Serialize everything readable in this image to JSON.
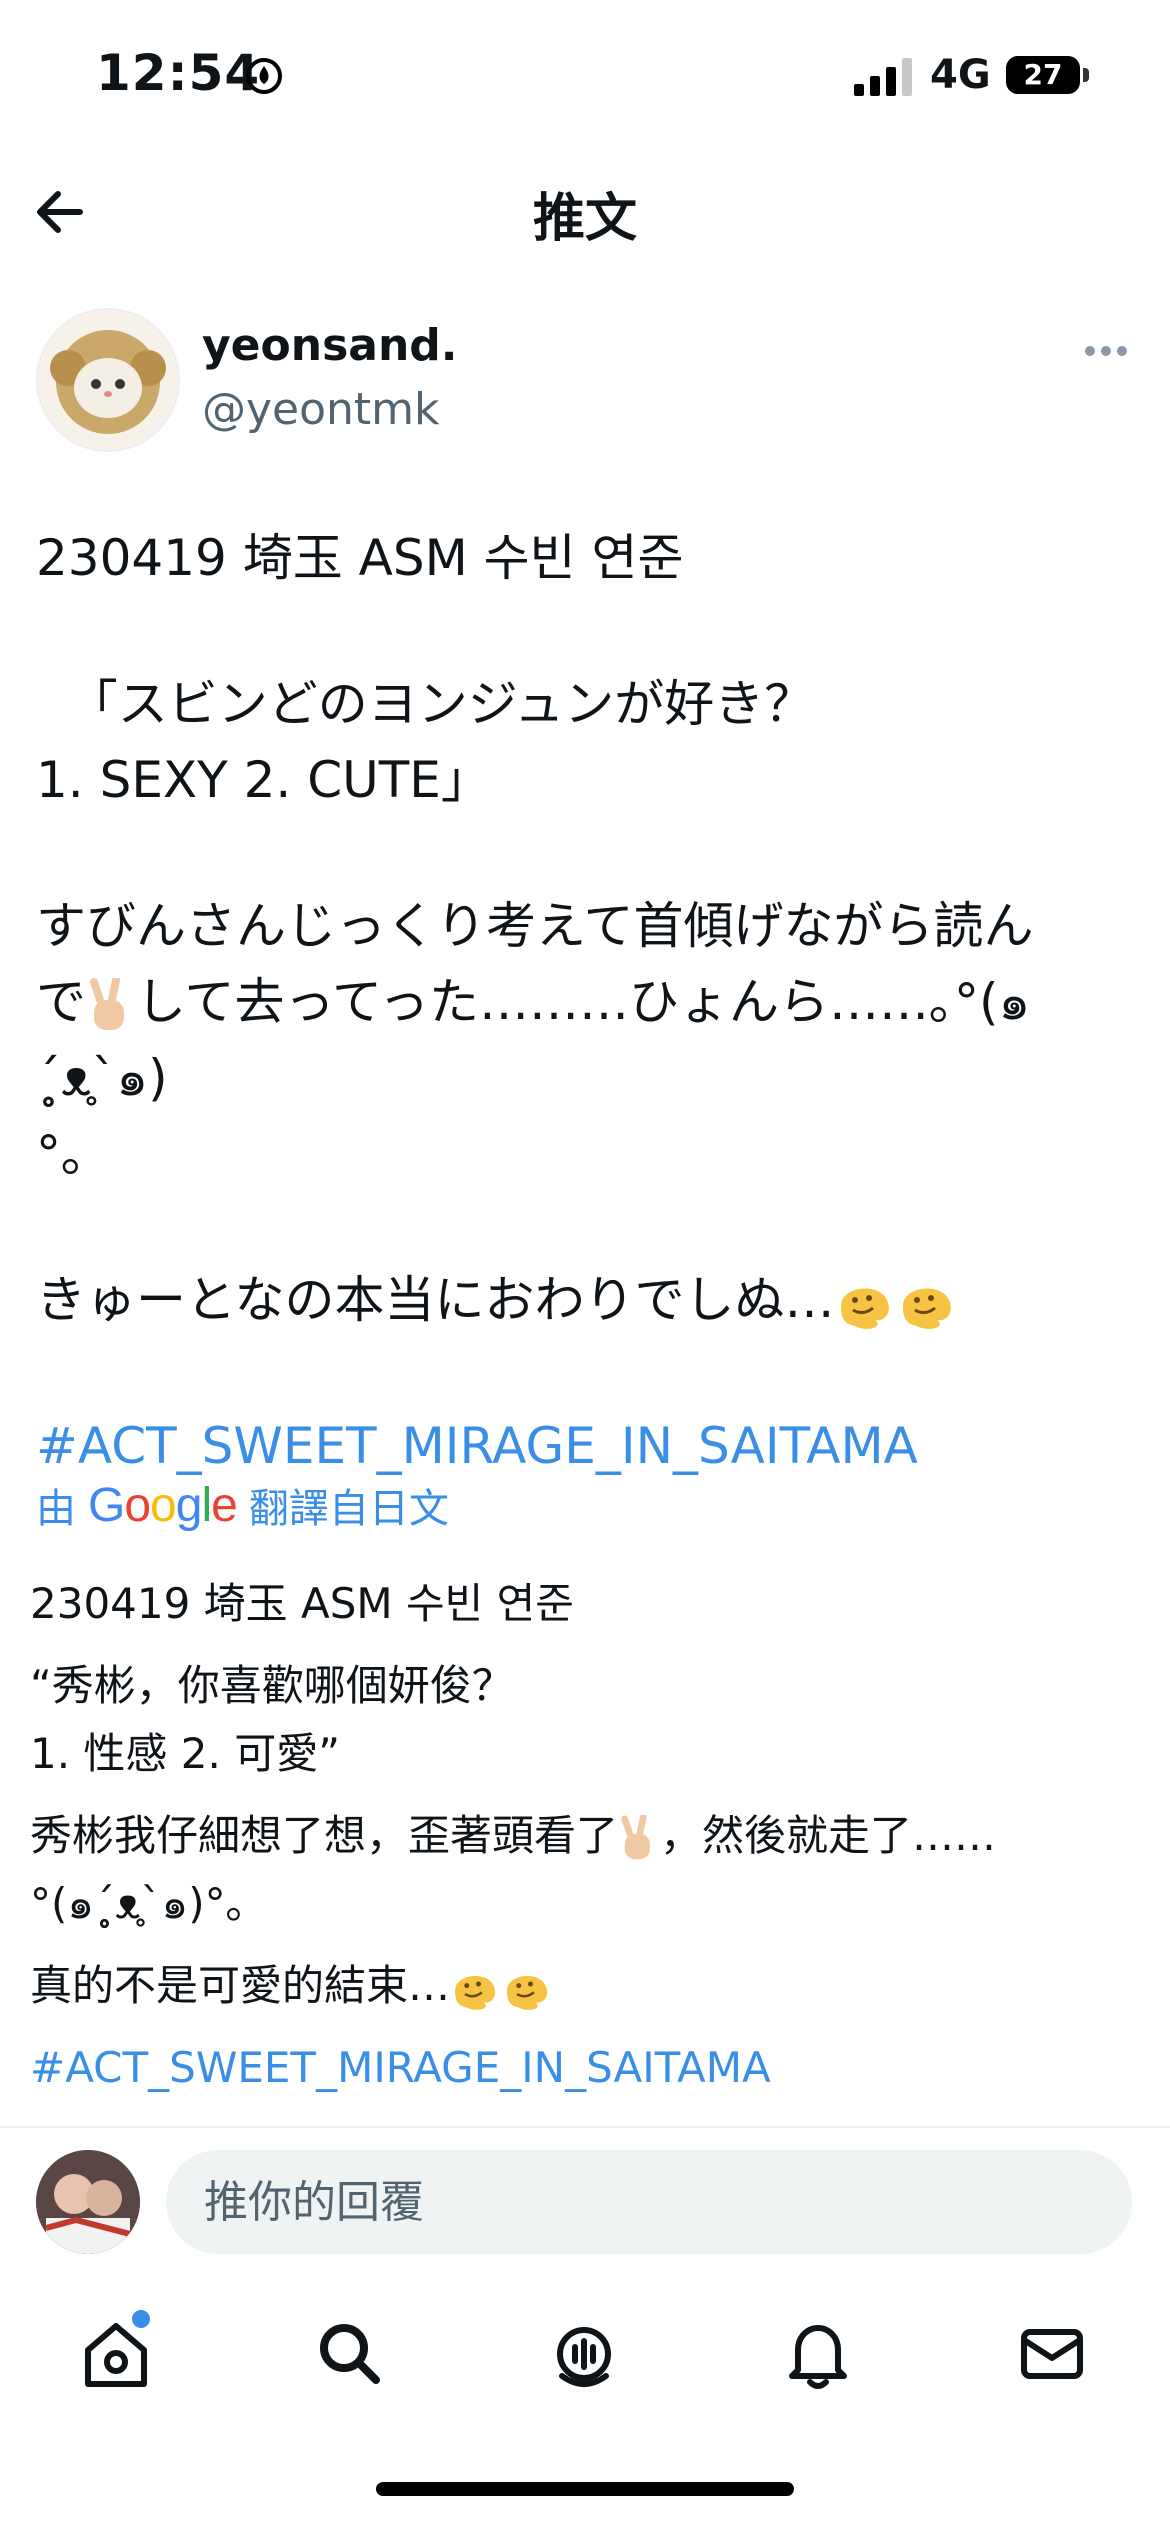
{
  "status_bar": {
    "time": "12:54",
    "network": "4G",
    "battery": "27"
  },
  "header": {
    "title": "推文"
  },
  "author": {
    "name": "yeonsand.",
    "handle": "@yeontmk"
  },
  "tweet": {
    "line1": "230419 埼玉 ASM 수빈 연준",
    "line2": "「スビンどのヨンジュンが好き？",
    "line3": "1. SEXY 2. CUTE」",
    "line4a": "すびんさんじっくり考えて首傾げながら読ん",
    "line4b_pre": "で",
    "line4b_post": "して去ってった………ひょんら……｡°(๑´̥̥̥ᴥ̥̥̥`๑)",
    "line4c": "°｡",
    "line5": "きゅーとなの本当におわりでしぬ…",
    "hashtag": "#ACT_SWEET_MIRAGE_IN_SAITAMA"
  },
  "translation": {
    "by": "由",
    "google": "Google",
    "from": "翻譯自日文",
    "line1": "230419 埼玉 ASM 수빈 연준",
    "line2": "“秀彬，你喜歡哪個妍俊？",
    "line3": "1. 性感 2. 可愛”",
    "line4_pre": "秀彬我仔細想了想，歪著頭看了",
    "line4_post": "，然後就走了……",
    "line4b": "°(๑´̥̥̥ᴥ̥̥̥`๑)°｡",
    "line5": "真的不是可愛的結束…",
    "hashtag": "#ACT_SWEET_MIRAGE_IN_SAITAMA"
  },
  "reply": {
    "placeholder": "推你的回覆"
  },
  "nav": {
    "items": [
      "home-icon",
      "search-icon",
      "spaces-icon",
      "notifications-icon",
      "messages-icon"
    ]
  },
  "colors": {
    "link": "#3a8ee6",
    "secondary_text": "#536471"
  }
}
